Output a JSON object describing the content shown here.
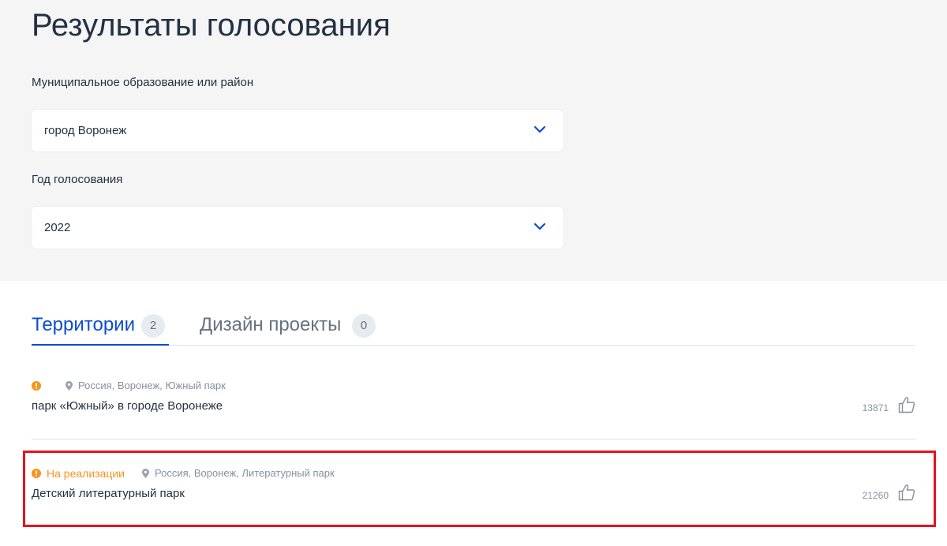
{
  "page": {
    "title": "Результаты голосования"
  },
  "filters": {
    "municipality": {
      "label": "Муниципальное образование или район",
      "value": "город Воронеж"
    },
    "year": {
      "label": "Год голосования",
      "value": "2022"
    }
  },
  "tabs": [
    {
      "label": "Территории",
      "count": "2",
      "active": true
    },
    {
      "label": "Дизайн проекты",
      "count": "0",
      "active": false
    }
  ],
  "items": [
    {
      "status": "",
      "location": "Россия, Воронеж, Южный парк",
      "title": "парк «Южный» в городе Воронеже",
      "votes": "13871"
    },
    {
      "status": "На реализации",
      "location": "Россия, Воронеж, Литературный парк",
      "title": "Детский литературный парк",
      "votes": "21260"
    }
  ],
  "colors": {
    "accent": "#0d4cd3",
    "status": "#f7941d",
    "highlight": "#e3141f",
    "muted": "#86909c"
  },
  "icons": {
    "chevron": "chevron-down-icon",
    "status": "info-icon",
    "location": "pin-icon",
    "like": "thumbs-up-icon"
  }
}
